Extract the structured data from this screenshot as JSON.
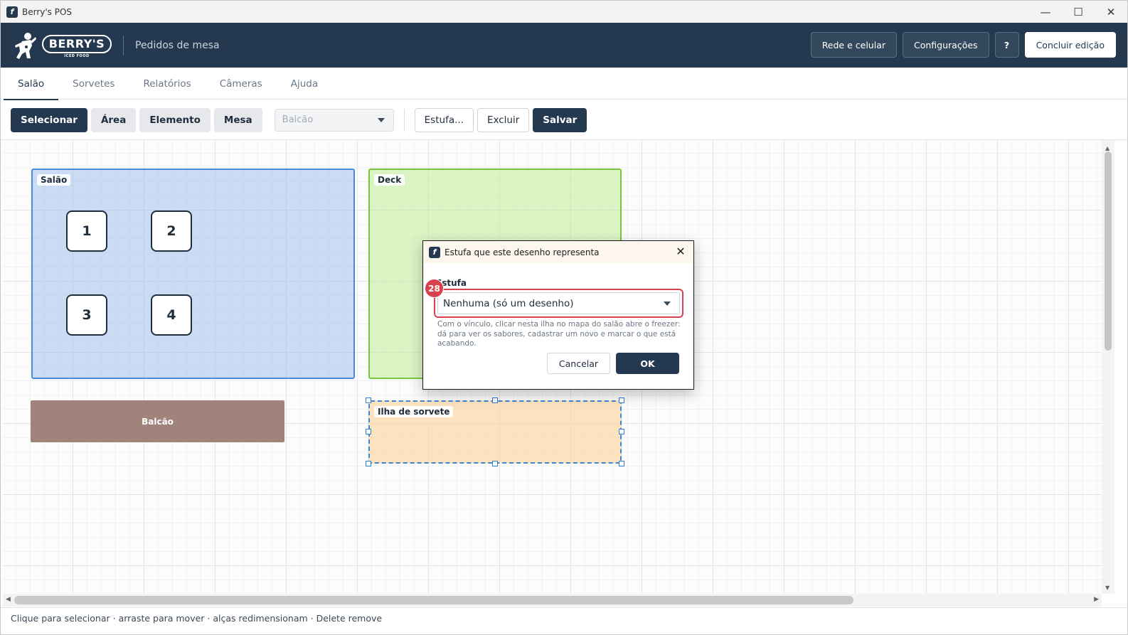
{
  "window": {
    "title": "Berry's POS",
    "controls": {
      "minimize": "—",
      "maximize": "☐",
      "close": "✕"
    }
  },
  "header": {
    "logo_text": "BERRY'S",
    "logo_subtext": "ICED FOOD",
    "subtitle": "Pedidos de mesa",
    "buttons": {
      "network": "Rede e celular",
      "settings": "Configurações",
      "help": "?",
      "finish": "Concluir edição"
    }
  },
  "tabs": [
    {
      "label": "Salão",
      "active": true
    },
    {
      "label": "Sorvetes"
    },
    {
      "label": "Relatórios"
    },
    {
      "label": "Câmeras"
    },
    {
      "label": "Ajuda"
    }
  ],
  "toolbar": {
    "select": "Selecionar",
    "area": "Área",
    "element": "Elemento",
    "table": "Mesa",
    "element_type_value": "Balcão",
    "freezer": "Estufa...",
    "delete": "Excluir",
    "save": "Salvar"
  },
  "canvas": {
    "areas": {
      "salao": "Salão",
      "deck": "Deck",
      "ilha": "Ilha de sorvete"
    },
    "tables": [
      "1",
      "2",
      "3",
      "4"
    ],
    "counter": "Balcão"
  },
  "status_bar": "Clique para selecionar · arraste para mover · alças redimensionam · Delete remove",
  "dialog": {
    "title": "Estufa que este desenho representa",
    "close": "✕",
    "field_label": "Estufa",
    "select_value": "Nenhuma (só um desenho)",
    "badge": "28",
    "help": "Com o vínculo, clicar nesta ilha no mapa do salão abre o freezer: dá para ver os sabores, cadastrar um novo e marcar o que está acabando.",
    "cancel": "Cancelar",
    "ok": "OK"
  },
  "colors": {
    "brand_dark": "#24394f",
    "salao_fill": "#8db4eb",
    "deck_fill": "#beec96",
    "ilha_fill": "#fad5a0",
    "counter_fill": "#a0847b",
    "highlight": "#d9414f"
  }
}
